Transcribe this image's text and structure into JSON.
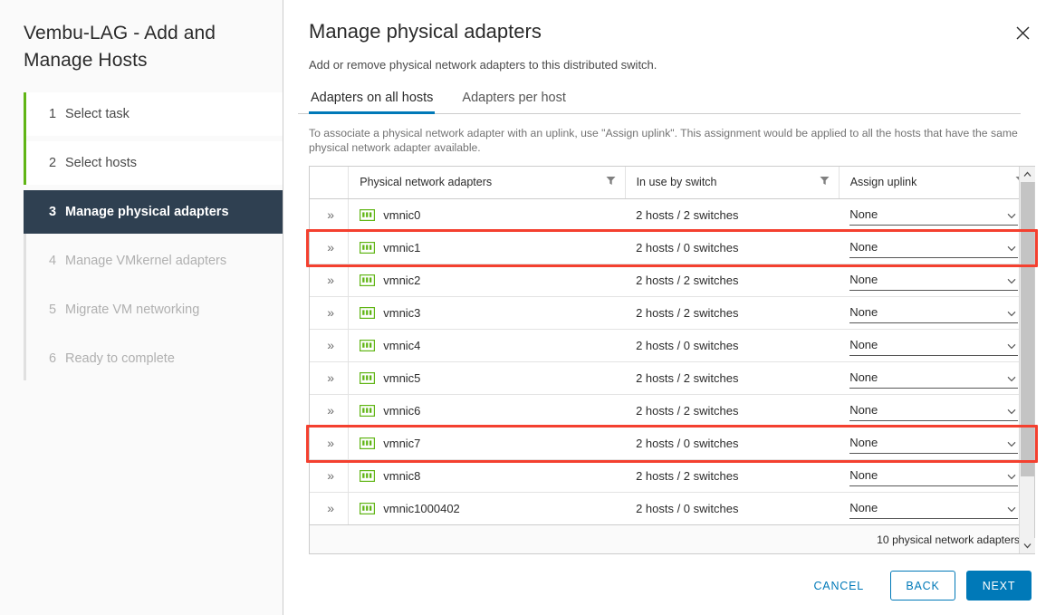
{
  "sidebar": {
    "title": "Vembu-LAG - Add and Manage Hosts",
    "steps": [
      {
        "num": "1",
        "label": "Select task",
        "state": "done"
      },
      {
        "num": "2",
        "label": "Select hosts",
        "state": "done"
      },
      {
        "num": "3",
        "label": "Manage physical adapters",
        "state": "active"
      },
      {
        "num": "4",
        "label": "Manage VMkernel adapters",
        "state": "upcoming"
      },
      {
        "num": "5",
        "label": "Migrate VM networking",
        "state": "upcoming"
      },
      {
        "num": "6",
        "label": "Ready to complete",
        "state": "upcoming"
      }
    ]
  },
  "panel": {
    "title": "Manage physical adapters",
    "subtitle": "Add or remove physical network adapters to this distributed switch.",
    "close_icon": "close-icon",
    "tabs": [
      {
        "label": "Adapters on all hosts",
        "active": true
      },
      {
        "label": "Adapters per host",
        "active": false
      }
    ],
    "hint": "To associate a physical network adapter with an uplink, use \"Assign uplink\". This assignment would be applied to all the hosts that have the same physical network adapter available."
  },
  "table": {
    "columns": [
      {
        "key": "expand",
        "label": ""
      },
      {
        "key": "name",
        "label": "Physical network adapters",
        "filter_icon": "filter-icon"
      },
      {
        "key": "inuse",
        "label": "In use by switch",
        "filter_icon": "filter-icon"
      },
      {
        "key": "uplink",
        "label": "Assign uplink",
        "filter_icon": "filter-icon"
      }
    ],
    "rows": [
      {
        "expand": "»",
        "icon": "nic-icon",
        "name": "vmnic0",
        "inuse": "2 hosts / 2 switches",
        "uplink": "None",
        "highlight": false
      },
      {
        "expand": "»",
        "icon": "nic-icon",
        "name": "vmnic1",
        "inuse": "2 hosts / 0 switches",
        "uplink": "None",
        "highlight": true
      },
      {
        "expand": "»",
        "icon": "nic-icon",
        "name": "vmnic2",
        "inuse": "2 hosts / 2 switches",
        "uplink": "None",
        "highlight": false
      },
      {
        "expand": "»",
        "icon": "nic-icon",
        "name": "vmnic3",
        "inuse": "2 hosts / 2 switches",
        "uplink": "None",
        "highlight": false
      },
      {
        "expand": "»",
        "icon": "nic-icon",
        "name": "vmnic4",
        "inuse": "2 hosts / 0 switches",
        "uplink": "None",
        "highlight": false
      },
      {
        "expand": "»",
        "icon": "nic-icon",
        "name": "vmnic5",
        "inuse": "2 hosts / 2 switches",
        "uplink": "None",
        "highlight": false
      },
      {
        "expand": "»",
        "icon": "nic-icon",
        "name": "vmnic6",
        "inuse": "2 hosts / 2 switches",
        "uplink": "None",
        "highlight": false
      },
      {
        "expand": "»",
        "icon": "nic-icon",
        "name": "vmnic7",
        "inuse": "2 hosts / 0 switches",
        "uplink": "None",
        "highlight": true
      },
      {
        "expand": "»",
        "icon": "nic-icon",
        "name": "vmnic8",
        "inuse": "2 hosts / 2 switches",
        "uplink": "None",
        "highlight": false
      },
      {
        "expand": "»",
        "icon": "nic-icon",
        "name": "vmnic1000402",
        "inuse": "2 hosts / 0 switches",
        "uplink": "None",
        "highlight": false
      }
    ],
    "footer_count": "10 physical network adapters",
    "scrollbar": {
      "up_icon": "chevron-up-icon",
      "down_icon": "chevron-down-icon"
    }
  },
  "buttons": {
    "cancel": "CANCEL",
    "back": "BACK",
    "next": "NEXT"
  },
  "colors": {
    "accent_blue": "#0079b8",
    "step_done_green": "#60b515",
    "step_active_navy": "#2f4051",
    "highlight_red": "#f4402f",
    "nic_green": "#60b515"
  }
}
